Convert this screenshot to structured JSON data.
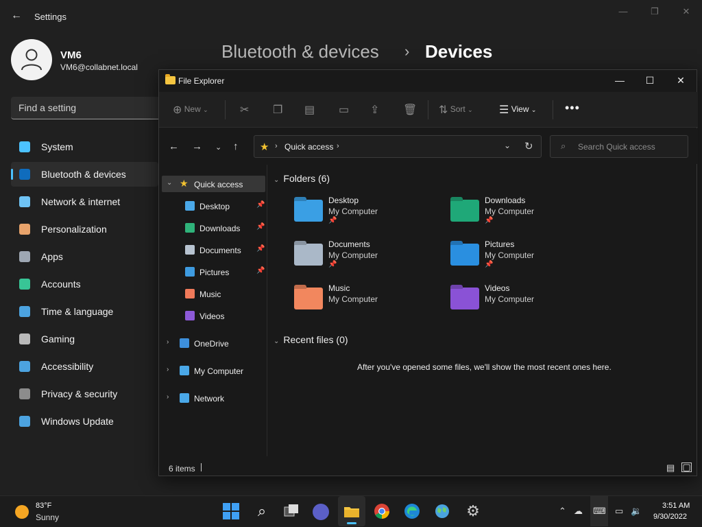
{
  "settings": {
    "window_title": "Settings",
    "user": {
      "name": "VM6",
      "email": "VM6@collabnet.local"
    },
    "search_placeholder": "Find a setting",
    "breadcrumb": {
      "parent": "Bluetooth & devices",
      "current": "Devices"
    },
    "nav": [
      {
        "label": "System",
        "icon": "system-icon",
        "color": "#4cc2ff"
      },
      {
        "label": "Bluetooth & devices",
        "icon": "bluetooth-icon",
        "color": "#0f6cbd",
        "active": true
      },
      {
        "label": "Network & internet",
        "icon": "wifi-icon",
        "color": "#6fc3f4"
      },
      {
        "label": "Personalization",
        "icon": "brush-icon",
        "color": "#e8a36b"
      },
      {
        "label": "Apps",
        "icon": "apps-icon",
        "color": "#9ea7b3"
      },
      {
        "label": "Accounts",
        "icon": "person-icon",
        "color": "#38c596"
      },
      {
        "label": "Time & language",
        "icon": "globe-clock-icon",
        "color": "#4ca3e0"
      },
      {
        "label": "Gaming",
        "icon": "controller-icon",
        "color": "#b9b9b9"
      },
      {
        "label": "Accessibility",
        "icon": "accessibility-icon",
        "color": "#4ca3e0"
      },
      {
        "label": "Privacy & security",
        "icon": "shield-icon",
        "color": "#8c8c8c"
      },
      {
        "label": "Windows Update",
        "icon": "update-icon",
        "color": "#4ca3e0"
      }
    ]
  },
  "explorer": {
    "title": "File Explorer",
    "commands": {
      "new": "New",
      "sort": "Sort",
      "view": "View"
    },
    "address": {
      "location": "Quick access"
    },
    "search_placeholder": "Search Quick access",
    "tree": {
      "quick_access": "Quick access",
      "pinned": [
        {
          "label": "Desktop",
          "color": "#4aa8e8",
          "pinned": true
        },
        {
          "label": "Downloads",
          "color": "#2fb37a",
          "pinned": true
        },
        {
          "label": "Documents",
          "color": "#b7c3d0",
          "pinned": true
        },
        {
          "label": "Pictures",
          "color": "#3e9be0",
          "pinned": true
        },
        {
          "label": "Music",
          "color": "#f07a5a",
          "pinned": false
        },
        {
          "label": "Videos",
          "color": "#8d5ad8",
          "pinned": false
        }
      ],
      "roots": [
        "OneDrive",
        "My Computer",
        "Network"
      ]
    },
    "folders_heading": "Folders (6)",
    "folders": [
      {
        "name": "Desktop",
        "location": "My Computer",
        "pinned": true,
        "color": "#3a9fe4"
      },
      {
        "name": "Downloads",
        "location": "My Computer",
        "pinned": true,
        "color": "#1fa878"
      },
      {
        "name": "Documents",
        "location": "My Computer",
        "pinned": true,
        "color": "#aab8c8"
      },
      {
        "name": "Pictures",
        "location": "My Computer",
        "pinned": true,
        "color": "#2a8fe0"
      },
      {
        "name": "Music",
        "location": "My Computer",
        "pinned": false,
        "color": "#f2875e"
      },
      {
        "name": "Videos",
        "location": "My Computer",
        "pinned": false,
        "color": "#8a52d6"
      }
    ],
    "recent_heading": "Recent files (0)",
    "recent_empty": "After you've opened some files, we'll show the most recent ones here.",
    "status": "6 items"
  },
  "taskbar": {
    "weather": {
      "temp": "83°F",
      "condition": "Sunny"
    },
    "clock": {
      "time": "3:51 AM",
      "date": "9/30/2022"
    }
  }
}
